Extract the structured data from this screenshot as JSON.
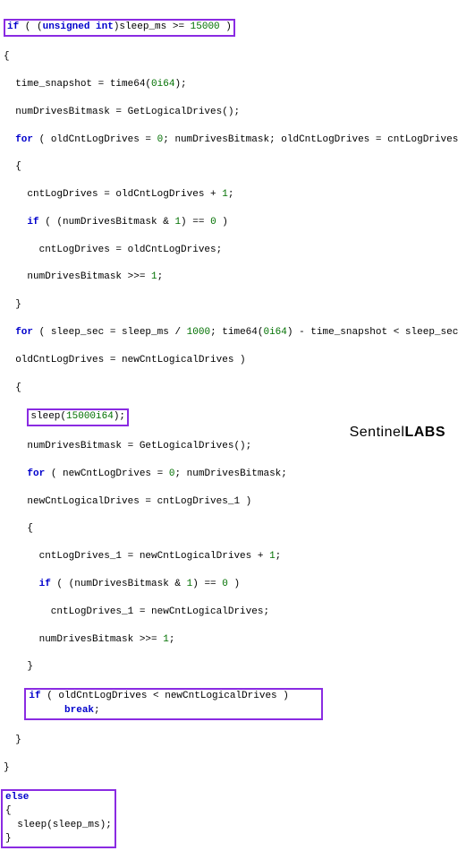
{
  "code": {
    "l1a": "if",
    "l1b": " ( (",
    "l1c": "unsigned int",
    "l1d": ")sleep_ms >= ",
    "l1e": "15000",
    "l1f": " )",
    "l2": "{",
    "l3a": "  time_snapshot = time64(",
    "l3b": "0i64",
    "l3c": ");",
    "l4": "  numDrivesBitmask = GetLogicalDrives();",
    "l5a": "  ",
    "l5b": "for",
    "l5c": " ( oldCntLogDrives = ",
    "l5d": "0",
    "l5e": "; numDrivesBitmask; oldCntLogDrives = cntLogDrives )",
    "l6": "  {",
    "l7a": "    cntLogDrives = oldCntLogDrives + ",
    "l7b": "1",
    "l7c": ";",
    "l8a": "    ",
    "l8b": "if",
    "l8c": " ( (numDrivesBitmask & ",
    "l8d": "1",
    "l8e": ") == ",
    "l8f": "0",
    "l8g": " )",
    "l9": "      cntLogDrives = oldCntLogDrives;",
    "l10a": "    numDrivesBitmask >>= ",
    "l10b": "1",
    "l10c": ";",
    "l11": "  }",
    "l12a": "  ",
    "l12b": "for",
    "l12c": " ( sleep_sec = sleep_ms / ",
    "l12d": "1000",
    "l12e": "; time64(",
    "l12f": "0i64",
    "l12g": ") - time_snapshot < sleep_sec;",
    "l13": "  oldCntLogDrives = newCntLogicalDrives )",
    "l14": "  {",
    "l15a": "    ",
    "l15b": "sleep(",
    "l15c": "15000i64",
    "l15d": ");",
    "l16": "    numDrivesBitmask = GetLogicalDrives();",
    "l17a": "    ",
    "l17b": "for",
    "l17c": " ( newCntLogDrives = ",
    "l17d": "0",
    "l17e": "; numDrivesBitmask;",
    "l18": "    newCntLogicalDrives = cntLogDrives_1 )",
    "l19": "    {",
    "l20a": "      cntLogDrives_1 = newCntLogicalDrives + ",
    "l20b": "1",
    "l20c": ";",
    "l21a": "      ",
    "l21b": "if",
    "l21c": " ( (numDrivesBitmask & ",
    "l21d": "1",
    "l21e": ") == ",
    "l21f": "0",
    "l21g": " )",
    "l22": "        cntLogDrives_1 = newCntLogicalDrives;",
    "l23a": "      numDrivesBitmask >>= ",
    "l23b": "1",
    "l23c": ";",
    "l24": "    }",
    "l25a": "    ",
    "l25b_if": "if",
    "l25c": " ( oldCntLogDrives < newCntLogicalDrives )",
    "l26a": "      ",
    "l26b": "break",
    "l26c": ";",
    "l27": "  }",
    "l28": "}",
    "l29": "else",
    "l30": "{",
    "l31": "  sleep(sleep_ms);",
    "l32": "}",
    "spacer25": "                                     "
  },
  "branding": {
    "part1": "Sentinel",
    "part2": "LABS"
  },
  "highlight_color": "#8a2be2"
}
